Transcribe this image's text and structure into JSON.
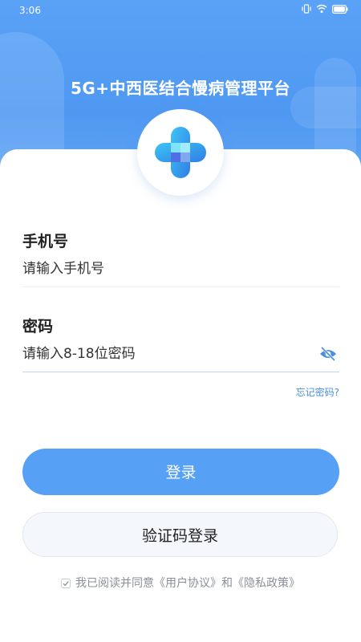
{
  "status_bar": {
    "time": "3:06",
    "icons": [
      "vibrate-icon",
      "wifi-icon",
      "battery-icon"
    ]
  },
  "app": {
    "title": "5G+中西医结合慢病管理平台",
    "logo_icon": "cross-logo-icon"
  },
  "form": {
    "phone": {
      "label": "手机号",
      "value": "",
      "placeholder": "请输入手机号"
    },
    "password": {
      "label": "密码",
      "value": "",
      "placeholder": "请输入8-18位密码",
      "visibility_icon": "eye-off-icon"
    },
    "forgot_label": "忘记密码?"
  },
  "actions": {
    "login_label": "登录",
    "sms_login_label": "验证码登录"
  },
  "agreement": {
    "checked": true,
    "text": "我已阅读并同意《用户协议》和《隐私政策》"
  },
  "colors": {
    "primary": "#56a0f5",
    "hero_gradient_top": "#5aa2f6",
    "link": "#4a8fe0"
  }
}
